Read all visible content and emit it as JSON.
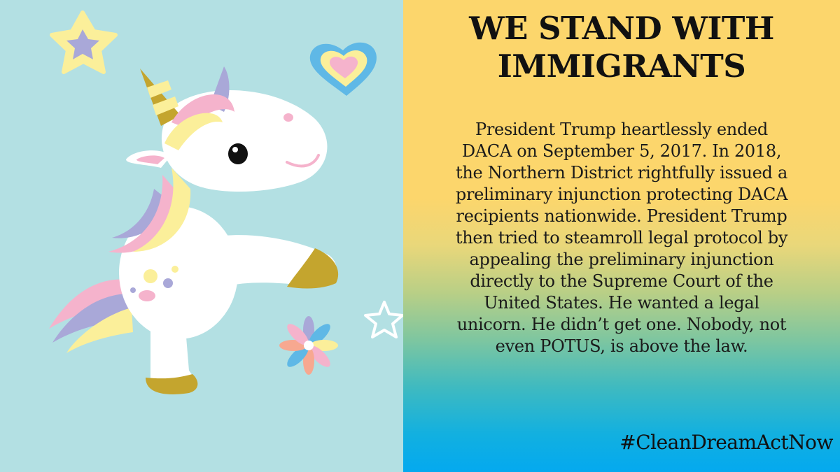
{
  "colors": {
    "left_background": "#b3e0e3",
    "gradient_top": "#fcd66c",
    "gradient_bottom": "#04a9ef",
    "text": "#111111"
  },
  "headline": {
    "line1": "WE STAND WITH",
    "line2": "IMMIGRANTS"
  },
  "body": {
    "lines": [
      "President Trump heartlessly ended",
      "DACA on September 5, 2017.  In 2018,",
      "the Northern District rightfully issued a",
      "preliminary injunction protecting DACA",
      "recipients nationwide.  President Trump",
      "then tried to steamroll legal protocol by",
      "appealing the preliminary injunction",
      "directly to the Supreme Court of the",
      "United States. He wanted a legal",
      "unicorn.  He didn’t get one. Nobody, not",
      "even POTUS, is above the law."
    ]
  },
  "hashtag": "#CleanDreamActNow",
  "illustration": {
    "icons": [
      "unicorn-illustration",
      "star-icon",
      "heart-icon",
      "flower-icon",
      "star-outline-icon"
    ]
  }
}
